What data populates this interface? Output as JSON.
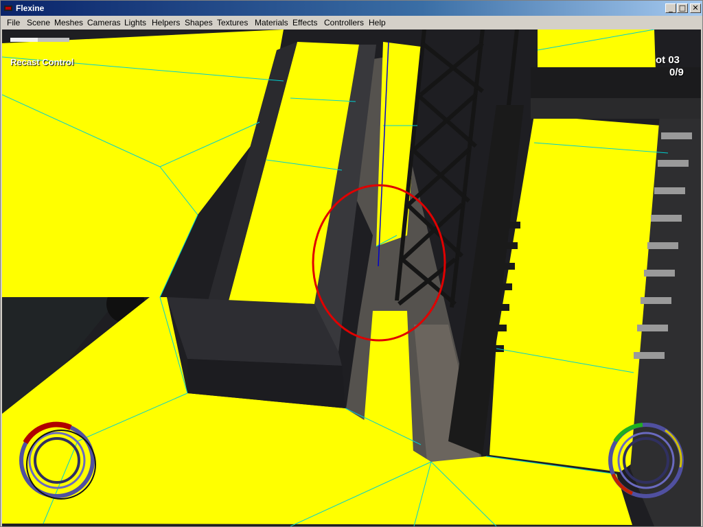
{
  "window": {
    "title": "Flexine",
    "controls": {
      "minimize": "_",
      "maximize": "□",
      "close": "✕"
    }
  },
  "menu": {
    "items": [
      "File",
      "Scene",
      "Meshes",
      "Cameras",
      "Lights",
      "Helpers",
      "Shapes",
      "Textures",
      "Materials",
      "Effects",
      "Controllers",
      "Help"
    ]
  },
  "hud": {
    "overlay_label": "Recast Control",
    "slot_label": "ot 03",
    "counter": "0/9"
  },
  "colors": {
    "navmesh": "#ffff00",
    "navmesh_edges": "#00cccc",
    "highlight_ellipse": "#e00000",
    "titlebar_start": "#0a246a"
  },
  "icons": {
    "left_gauge": "circular-health-gauge",
    "right_gauge": "circular-stamina-gauge"
  }
}
